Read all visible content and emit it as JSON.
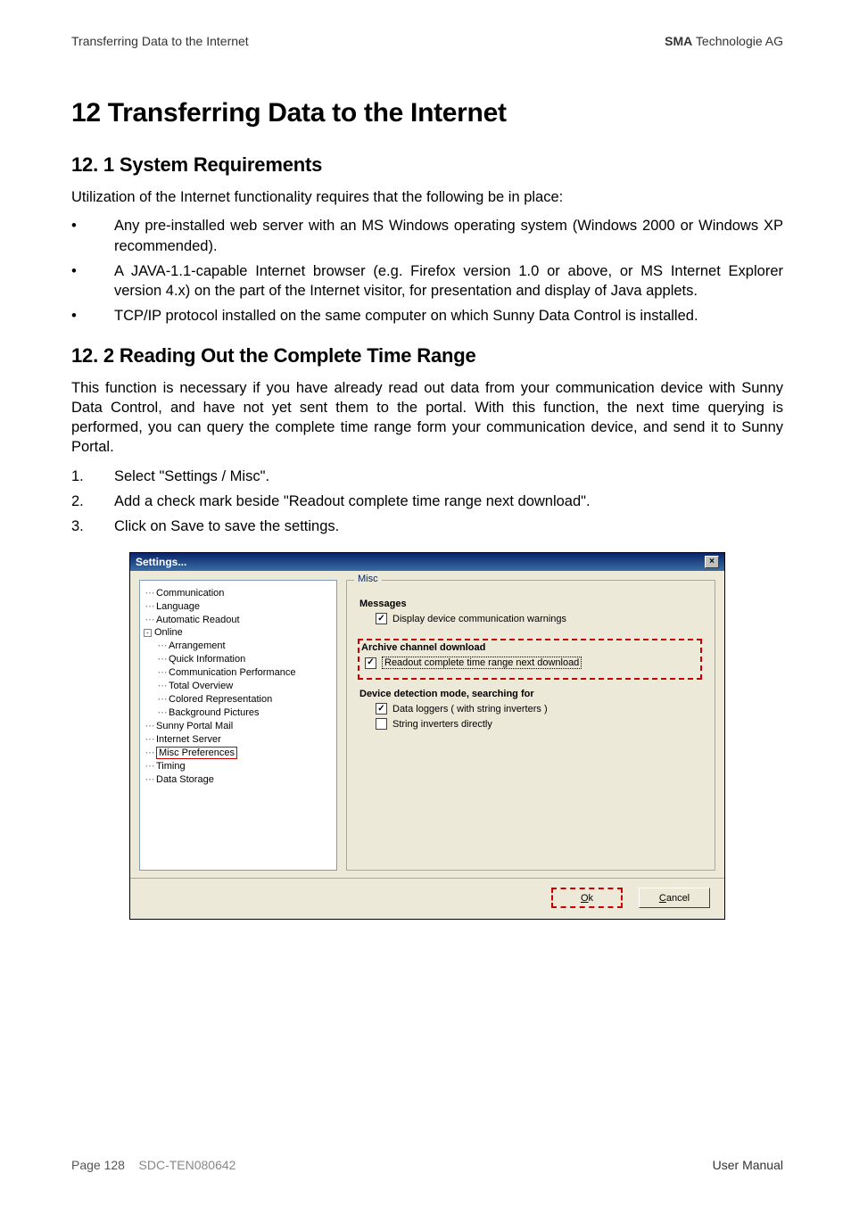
{
  "header": {
    "left": "Transferring Data to the Internet",
    "right_bold": "SMA",
    "right_rest": " Technologie AG"
  },
  "h1": "12 Transferring Data to the Internet",
  "sec1": {
    "h": "12. 1 System Requirements",
    "intro": "Utilization of the Internet functionality requires that the following be in place:",
    "bullets": [
      "Any pre-installed web server with an MS Windows operating system (Windows 2000 or Windows XP recommended).",
      "A JAVA-1.1-capable Internet browser (e.g. Firefox version 1.0 or above, or MS Internet Explorer version 4.x) on the part of the Internet visitor, for presentation and display of Java applets.",
      "TCP/IP protocol installed on the same computer on which Sunny Data Control is installed."
    ]
  },
  "sec2": {
    "h": "12. 2 Reading Out the Complete Time Range",
    "intro": "This function is necessary if you have already read out data from your communication device with Sunny Data Control, and have not yet sent them to the portal. With this function, the next time querying is performed, you can query the complete time range form your communication device, and send it to Sunny Portal.",
    "steps": [
      "Select \"Settings / Misc\".",
      "Add a check mark beside \"Readout complete time range next download\".",
      "Click on Save to save the settings."
    ]
  },
  "dialog": {
    "title": "Settings...",
    "tree": {
      "items": [
        "Communication",
        "Language",
        "Automatic Readout",
        "Online",
        "Arrangement",
        "Quick Information",
        "Communication Performance",
        "Total Overview",
        "Colored Representation",
        "Background Pictures",
        "Sunny Portal Mail",
        "Internet Server",
        "Misc Preferences",
        "Timing",
        "Data Storage"
      ],
      "selected": "Misc Preferences"
    },
    "group_title": "Misc",
    "messages": {
      "heading": "Messages",
      "chk1": "Display device communication warnings"
    },
    "archive": {
      "heading": "Archive channel download",
      "chk1": "Readout complete time range next download"
    },
    "detect": {
      "heading": "Device detection mode, searching for",
      "chk1": "Data loggers ( with string inverters )",
      "chk2": "String inverters directly"
    },
    "ok_label": "Ok",
    "ok_accel": "O",
    "cancel_label": "Cancel",
    "cancel_accel": "C"
  },
  "footer": {
    "page": "Page 128",
    "doc": "SDC-TEN080642",
    "right": "User Manual"
  }
}
